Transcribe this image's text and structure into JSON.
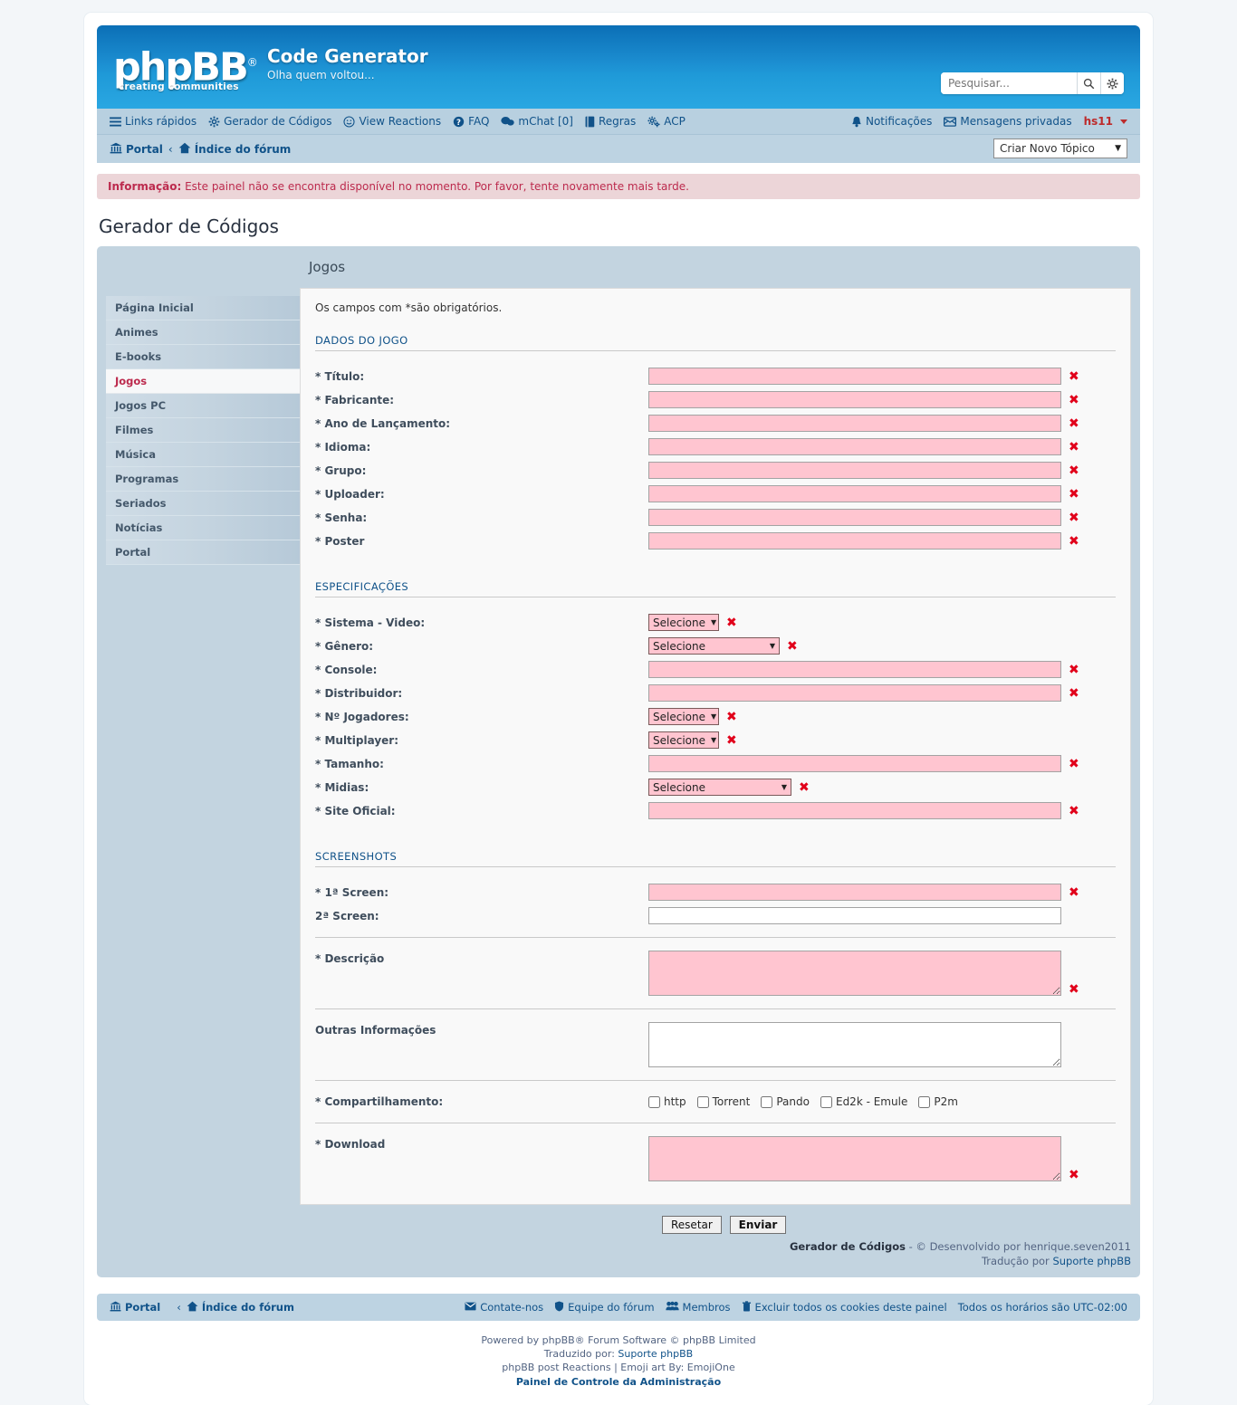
{
  "header": {
    "logo_text": "phpBB",
    "logo_reg": "®",
    "logo_tagline": "creating communities",
    "site_title": "Code Generator",
    "site_description": "Olha quem voltou...",
    "search_placeholder": "Pesquisar...",
    "search_value": ""
  },
  "nav": {
    "left_items": [
      {
        "label": "Links rápidos",
        "icon": "hamburger-icon"
      },
      {
        "label": "Gerador de Códigos",
        "icon": "gear-icon"
      },
      {
        "label": "View Reactions",
        "icon": "smiley-icon"
      },
      {
        "label": "FAQ",
        "icon": "question-icon"
      },
      {
        "label": "mChat [0]",
        "icon": "chat-icon"
      },
      {
        "label": "Regras",
        "icon": "book-icon"
      },
      {
        "label": "ACP",
        "icon": "gears-icon"
      }
    ],
    "right_items": [
      {
        "label": "Notificações",
        "icon": "bell-icon"
      },
      {
        "label": "Mensagens privadas",
        "icon": "envelope-icon"
      }
    ],
    "username": "hs11"
  },
  "breadcrumb": {
    "portal": "Portal",
    "separator": "‹",
    "forum_index": "Índice do fórum",
    "topic_select_value": "Criar Novo Tópico"
  },
  "info_message": {
    "label": "Informação:",
    "text": "Este painel não se encontra disponível no momento. Por favor, tente novamente mais tarde."
  },
  "page": {
    "title": "Gerador de Códigos",
    "content_title": "Jogos",
    "required_note": "Os campos com *são obrigatórios."
  },
  "sidebar": {
    "items": [
      {
        "label": "Página Inicial",
        "active": false
      },
      {
        "label": "Animes",
        "active": false
      },
      {
        "label": "E-books",
        "active": false
      },
      {
        "label": "Jogos",
        "active": true
      },
      {
        "label": "Jogos PC",
        "active": false
      },
      {
        "label": "Filmes",
        "active": false
      },
      {
        "label": "Música",
        "active": false
      },
      {
        "label": "Programas",
        "active": false
      },
      {
        "label": "Seriados",
        "active": false
      },
      {
        "label": "Notícias",
        "active": false
      },
      {
        "label": "Portal",
        "active": false
      }
    ]
  },
  "form": {
    "section_dados": "DADOS DO JOGO",
    "section_espec": "ESPECIFICAÇÕES",
    "section_screens": "SCREENSHOTS",
    "select_placeholder": "Selecione",
    "dados_fields": [
      {
        "label": "* Título:",
        "type": "text",
        "value": "",
        "required": true,
        "error": true
      },
      {
        "label": "* Fabricante:",
        "type": "text",
        "value": "",
        "required": true,
        "error": true
      },
      {
        "label": "* Ano de Lançamento:",
        "type": "text",
        "value": "",
        "required": true,
        "error": true
      },
      {
        "label": "* Idioma:",
        "type": "text",
        "value": "",
        "required": true,
        "error": true
      },
      {
        "label": "* Grupo:",
        "type": "text",
        "value": "",
        "required": true,
        "error": true
      },
      {
        "label": "* Uploader:",
        "type": "text",
        "value": "",
        "required": true,
        "error": true
      },
      {
        "label": "* Senha:",
        "type": "text",
        "value": "",
        "required": true,
        "error": true
      },
      {
        "label": "* Poster",
        "type": "text",
        "value": "",
        "required": true,
        "error": true
      }
    ],
    "espec_fields": [
      {
        "label": "* Sistema - Video:",
        "type": "select",
        "value": "Selecione",
        "size": "sm",
        "error": true
      },
      {
        "label": "* Gênero:",
        "type": "select",
        "value": "Selecione",
        "size": "md",
        "error": true
      },
      {
        "label": "* Console:",
        "type": "text",
        "value": "",
        "error": true
      },
      {
        "label": "* Distribuidor:",
        "type": "text",
        "value": "",
        "error": true
      },
      {
        "label": "* Nº Jogadores:",
        "type": "select",
        "value": "Selecione",
        "size": "sm",
        "error": true
      },
      {
        "label": "* Multiplayer:",
        "type": "select",
        "value": "Selecione",
        "size": "sm",
        "error": true
      },
      {
        "label": "* Tamanho:",
        "type": "text",
        "value": "",
        "error": true
      },
      {
        "label": "* Midias:",
        "type": "select",
        "value": "Selecione",
        "size": "lg",
        "error": true
      },
      {
        "label": "* Site Oficial:",
        "type": "text",
        "value": "",
        "error": true
      }
    ],
    "screen_fields": [
      {
        "label": "* 1ª Screen:",
        "type": "text",
        "value": "",
        "error": true
      },
      {
        "label": "2ª Screen:",
        "type": "text-plain",
        "value": "",
        "error": false
      }
    ],
    "descricao": {
      "label": "* Descrição",
      "value": "",
      "error": true
    },
    "outras": {
      "label": "Outras Informações",
      "value": "",
      "error": false
    },
    "compartilhamento": {
      "label": "* Compartilhamento:",
      "options": [
        {
          "label": "http",
          "checked": false
        },
        {
          "label": "Torrent",
          "checked": false
        },
        {
          "label": "Pando",
          "checked": false
        },
        {
          "label": "Ed2k - Emule",
          "checked": false
        },
        {
          "label": "P2m",
          "checked": false
        }
      ]
    },
    "download": {
      "label": "* Download",
      "value": "",
      "error": true
    }
  },
  "actions": {
    "reset_label": "Resetar",
    "submit_label": "Enviar"
  },
  "credit": {
    "app_name": "Gerador de Códigos",
    "dev_line": " - © Desenvolvido por henrique.seven2011",
    "translation_prefix": "Tradução por ",
    "translation_link": "Suporte phpBB"
  },
  "footer": {
    "portal": "Portal",
    "separator": "‹",
    "forum_index": "Índice do fórum",
    "links": [
      {
        "label": "Contate-nos",
        "icon": "envelope-icon"
      },
      {
        "label": "Equipe do fórum",
        "icon": "shield-icon"
      },
      {
        "label": "Membros",
        "icon": "people-icon"
      },
      {
        "label": "Excluir todos os cookies deste painel",
        "icon": "trash-icon"
      }
    ],
    "timezone": "Todos os horários são UTC-02:00",
    "credits_line1": "Powered by phpBB® Forum Software © phpBB Limited",
    "credits_line2_prefix": "Traduzido por: ",
    "credits_line2_link": "Suporte phpBB",
    "credits_line3": "phpBB post Reactions | Emoji art By: EmojiOne",
    "credits_acp": "Painel de Controle da Administração"
  },
  "colors": {
    "header_blue": "#1c8ed1",
    "nav_blue": "#bdd3e2",
    "panel_blue": "#c3d4e0",
    "link_blue": "#105289",
    "error_pink": "#ffc5d0",
    "error_red": "#e1001a",
    "username_red": "#bd2b2b",
    "info_bg": "#ecd5d8",
    "info_text": "#bc2a4d"
  }
}
